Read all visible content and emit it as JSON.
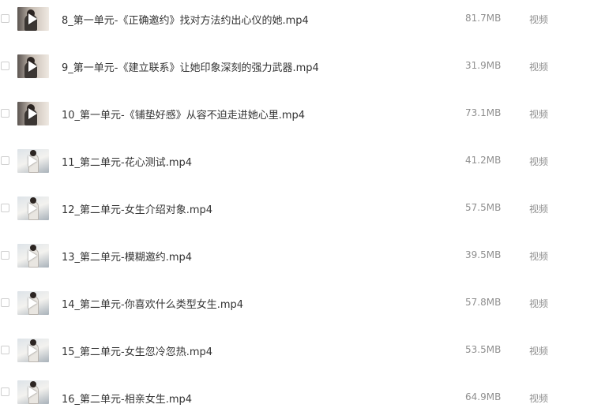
{
  "files": [
    {
      "name": "8_第一单元-《正确邀约》找对方法约出心仪的她.mp4",
      "size": "81.7MB",
      "type": "视频",
      "thumb": "thumb-indoor"
    },
    {
      "name": "9_第一单元-《建立联系》让她印象深刻的强力武器.mp4",
      "size": "31.9MB",
      "type": "视频",
      "thumb": "thumb-indoor"
    },
    {
      "name": "10_第一单元-《铺垫好感》从容不迫走进她心里.mp4",
      "size": "73.1MB",
      "type": "视频",
      "thumb": "thumb-indoor"
    },
    {
      "name": "11_第二单元-花心测试.mp4",
      "size": "41.2MB",
      "type": "视频",
      "thumb": "thumb-white-shirt"
    },
    {
      "name": "12_第二单元-女生介绍对象.mp4",
      "size": "57.5MB",
      "type": "视频",
      "thumb": "thumb-white-shirt"
    },
    {
      "name": "13_第二单元-模糊邀约.mp4",
      "size": "39.5MB",
      "type": "视频",
      "thumb": "thumb-white-shirt"
    },
    {
      "name": "14_第二单元-你喜欢什么类型女生.mp4",
      "size": "57.8MB",
      "type": "视频",
      "thumb": "thumb-white-shirt"
    },
    {
      "name": "15_第二单元-女生忽冷忽热.mp4",
      "size": "53.5MB",
      "type": "视频",
      "thumb": "thumb-white-shirt"
    },
    {
      "name": "16_第二单元-相亲女生.mp4",
      "size": "64.9MB",
      "type": "视频",
      "thumb": "thumb-white-shirt"
    }
  ]
}
